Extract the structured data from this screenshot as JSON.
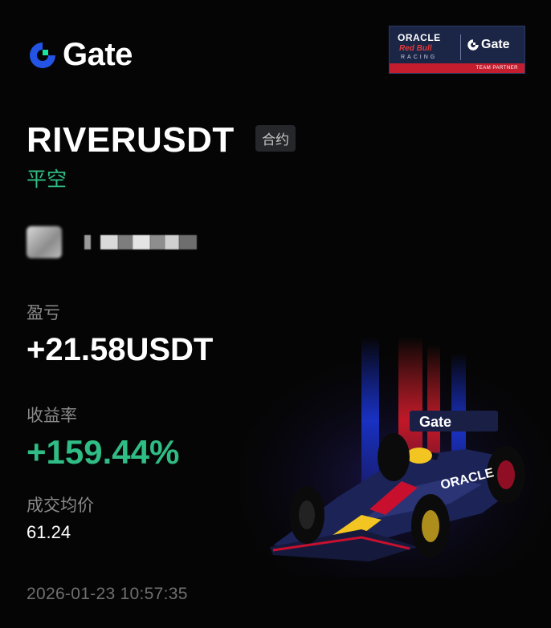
{
  "brand": {
    "name": "Gate",
    "primary_color": "#2354e6",
    "accent_color": "#17e6a1"
  },
  "partner": {
    "line1": "ORACLE",
    "line2": "Red Bull",
    "line3": "RACING",
    "brand": "Gate",
    "tag": "TEAM PARTNER"
  },
  "trade": {
    "symbol": "RIVERUSDT",
    "badge": "合约",
    "side": "平空",
    "pnl_label": "盈亏",
    "pnl_value": "+21.58USDT",
    "roi_label": "收益率",
    "roi_value": "+159.44%",
    "price_label": "成交均价",
    "price_value": "61.24",
    "timestamp": "2026-01-23 10:57:35"
  },
  "colors": {
    "positive": "#2fbd85",
    "muted": "#8a8a8a",
    "background": "#050505"
  },
  "icons": {
    "logo": "gate-logo-icon",
    "car": "f1-car-illustration"
  }
}
